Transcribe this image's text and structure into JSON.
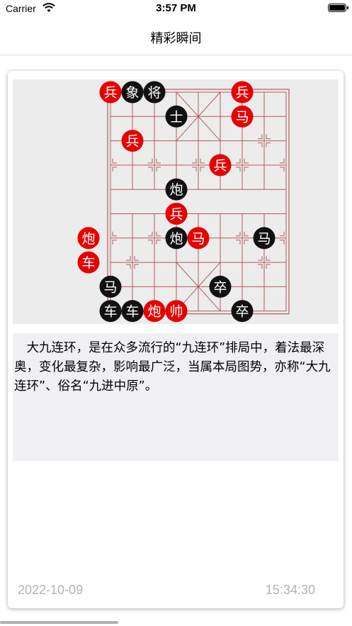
{
  "status_bar": {
    "carrier": "Carrier",
    "time": "3:57 PM"
  },
  "nav": {
    "title": "精彩瞬间"
  },
  "card": {
    "description": "大九连环，是在众多流行的“九连环”排局中，着法最深奥，变化最复杂，影响最广泛，当属本局图势，亦称“大九连环”、俗名“九进中原”。",
    "date": "2022-10-09",
    "time": "15:34:30"
  },
  "board": {
    "line_color": "#b25b5b",
    "red_piece_color": "#e60000",
    "black_piece_color": "#111111",
    "pieces": [
      {
        "label": "兵",
        "side": "red",
        "file": 0,
        "rank": 0
      },
      {
        "label": "象",
        "side": "black",
        "file": 1,
        "rank": 0
      },
      {
        "label": "将",
        "side": "black",
        "file": 2,
        "rank": 0
      },
      {
        "label": "兵",
        "side": "red",
        "file": 6,
        "rank": 0
      },
      {
        "label": "士",
        "side": "black",
        "file": 3,
        "rank": 1
      },
      {
        "label": "马",
        "side": "red",
        "file": 6,
        "rank": 1
      },
      {
        "label": "兵",
        "side": "red",
        "file": 1,
        "rank": 2
      },
      {
        "label": "兵",
        "side": "red",
        "file": 5,
        "rank": 3
      },
      {
        "label": "炮",
        "side": "black",
        "file": 3,
        "rank": 4
      },
      {
        "label": "兵",
        "side": "red",
        "file": 3,
        "rank": 5
      },
      {
        "label": "炮",
        "side": "red",
        "file": -1,
        "rank": 6
      },
      {
        "label": "炮",
        "side": "black",
        "file": 3,
        "rank": 6
      },
      {
        "label": "马",
        "side": "red",
        "file": 4,
        "rank": 6
      },
      {
        "label": "马",
        "side": "black",
        "file": 7,
        "rank": 6
      },
      {
        "label": "车",
        "side": "red",
        "file": -1,
        "rank": 7
      },
      {
        "label": "马",
        "side": "black",
        "file": 0,
        "rank": 8
      },
      {
        "label": "卒",
        "side": "black",
        "file": 5,
        "rank": 8
      },
      {
        "label": "车",
        "side": "black",
        "file": 0,
        "rank": 9
      },
      {
        "label": "车",
        "side": "black",
        "file": 1,
        "rank": 9
      },
      {
        "label": "炮",
        "side": "red",
        "file": 2,
        "rank": 9
      },
      {
        "label": "帅",
        "side": "red",
        "file": 3,
        "rank": 9
      },
      {
        "label": "卒",
        "side": "black",
        "file": 6,
        "rank": 9
      }
    ]
  }
}
